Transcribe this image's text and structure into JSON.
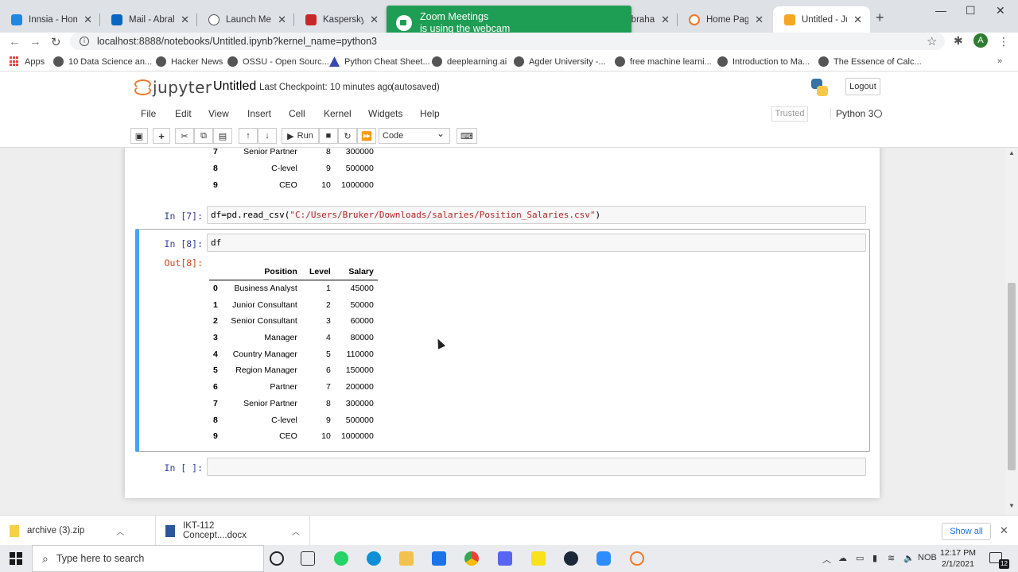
{
  "browser": {
    "tabs": [
      {
        "title": "Innsia - Home",
        "color": "#1e88e5"
      },
      {
        "title": "Mail - Abraham",
        "color": "#0a66c2"
      },
      {
        "title": "Launch Meeting",
        "color": "#555555"
      },
      {
        "title": "Kaspersky Prot",
        "color": "#c62828"
      },
      {
        "title": "abraha",
        "color": "#2e7d32"
      },
      {
        "title": "Home Page - S",
        "color": "#f37726"
      },
      {
        "title": "Untitled - Jupy",
        "color": "#f5a623"
      }
    ],
    "zoom_toast": {
      "line1": "Zoom Meetings",
      "line2": "is using the webcam"
    },
    "url": "localhost:8888/notebooks/Untitled.ipynb?kernel_name=python3",
    "profile_initial": "A",
    "bookmarks": [
      {
        "label": "Apps"
      },
      {
        "label": "10 Data Science an..."
      },
      {
        "label": "Hacker News"
      },
      {
        "label": "OSSU - Open Sourc..."
      },
      {
        "label": "Python Cheat Sheet..."
      },
      {
        "label": "deeplearning.ai"
      },
      {
        "label": "Agder University -..."
      },
      {
        "label": "free machine learni..."
      },
      {
        "label": "Introduction to Ma..."
      },
      {
        "label": "The Essence of Calc..."
      }
    ],
    "bookmarks_more": "»"
  },
  "jupyter": {
    "logo_text": "jupyter",
    "notebook_title": "Untitled",
    "checkpoint": "Last Checkpoint: 10 minutes ago",
    "autosaved": "(autosaved)",
    "logout": "Logout",
    "menu": [
      "File",
      "Edit",
      "View",
      "Insert",
      "Cell",
      "Kernel",
      "Widgets",
      "Help"
    ],
    "trusted": "Trusted",
    "kernel": "Python 3",
    "run_label": "Run",
    "cell_type": "Code"
  },
  "cells": {
    "prev_output_rows": [
      {
        "idx": "7",
        "position": "Senior Partner",
        "level": "8",
        "salary": "300000"
      },
      {
        "idx": "8",
        "position": "C-level",
        "level": "9",
        "salary": "500000"
      },
      {
        "idx": "9",
        "position": "CEO",
        "level": "10",
        "salary": "1000000"
      }
    ],
    "cell7": {
      "prompt": "In [7]:",
      "code_pre": "df=pd.read_csv(",
      "code_str": "\"C:/Users/Bruker/Downloads/salaries/Position_Salaries.csv\"",
      "code_post": ")"
    },
    "cell8": {
      "prompt": "In [8]:",
      "code": "df",
      "out_prompt": "Out[8]:"
    },
    "table_headers": [
      "Position",
      "Level",
      "Salary"
    ],
    "table_rows": [
      {
        "idx": "0",
        "position": "Business Analyst",
        "level": "1",
        "salary": "45000"
      },
      {
        "idx": "1",
        "position": "Junior Consultant",
        "level": "2",
        "salary": "50000"
      },
      {
        "idx": "2",
        "position": "Senior Consultant",
        "level": "3",
        "salary": "60000"
      },
      {
        "idx": "3",
        "position": "Manager",
        "level": "4",
        "salary": "80000"
      },
      {
        "idx": "4",
        "position": "Country Manager",
        "level": "5",
        "salary": "110000"
      },
      {
        "idx": "5",
        "position": "Region Manager",
        "level": "6",
        "salary": "150000"
      },
      {
        "idx": "6",
        "position": "Partner",
        "level": "7",
        "salary": "200000"
      },
      {
        "idx": "7",
        "position": "Senior Partner",
        "level": "8",
        "salary": "300000"
      },
      {
        "idx": "8",
        "position": "C-level",
        "level": "9",
        "salary": "500000"
      },
      {
        "idx": "9",
        "position": "CEO",
        "level": "10",
        "salary": "1000000"
      }
    ],
    "empty_prompt": "In [ ]:"
  },
  "downloads": {
    "items": [
      {
        "name": "archive (3).zip"
      },
      {
        "name": "IKT-112 Concept....docx"
      }
    ],
    "show_all": "Show all"
  },
  "taskbar": {
    "search_placeholder": "Type here to search",
    "language": "NOB",
    "time": "12:17 PM",
    "date": "2/1/2021",
    "notifications": "12"
  }
}
